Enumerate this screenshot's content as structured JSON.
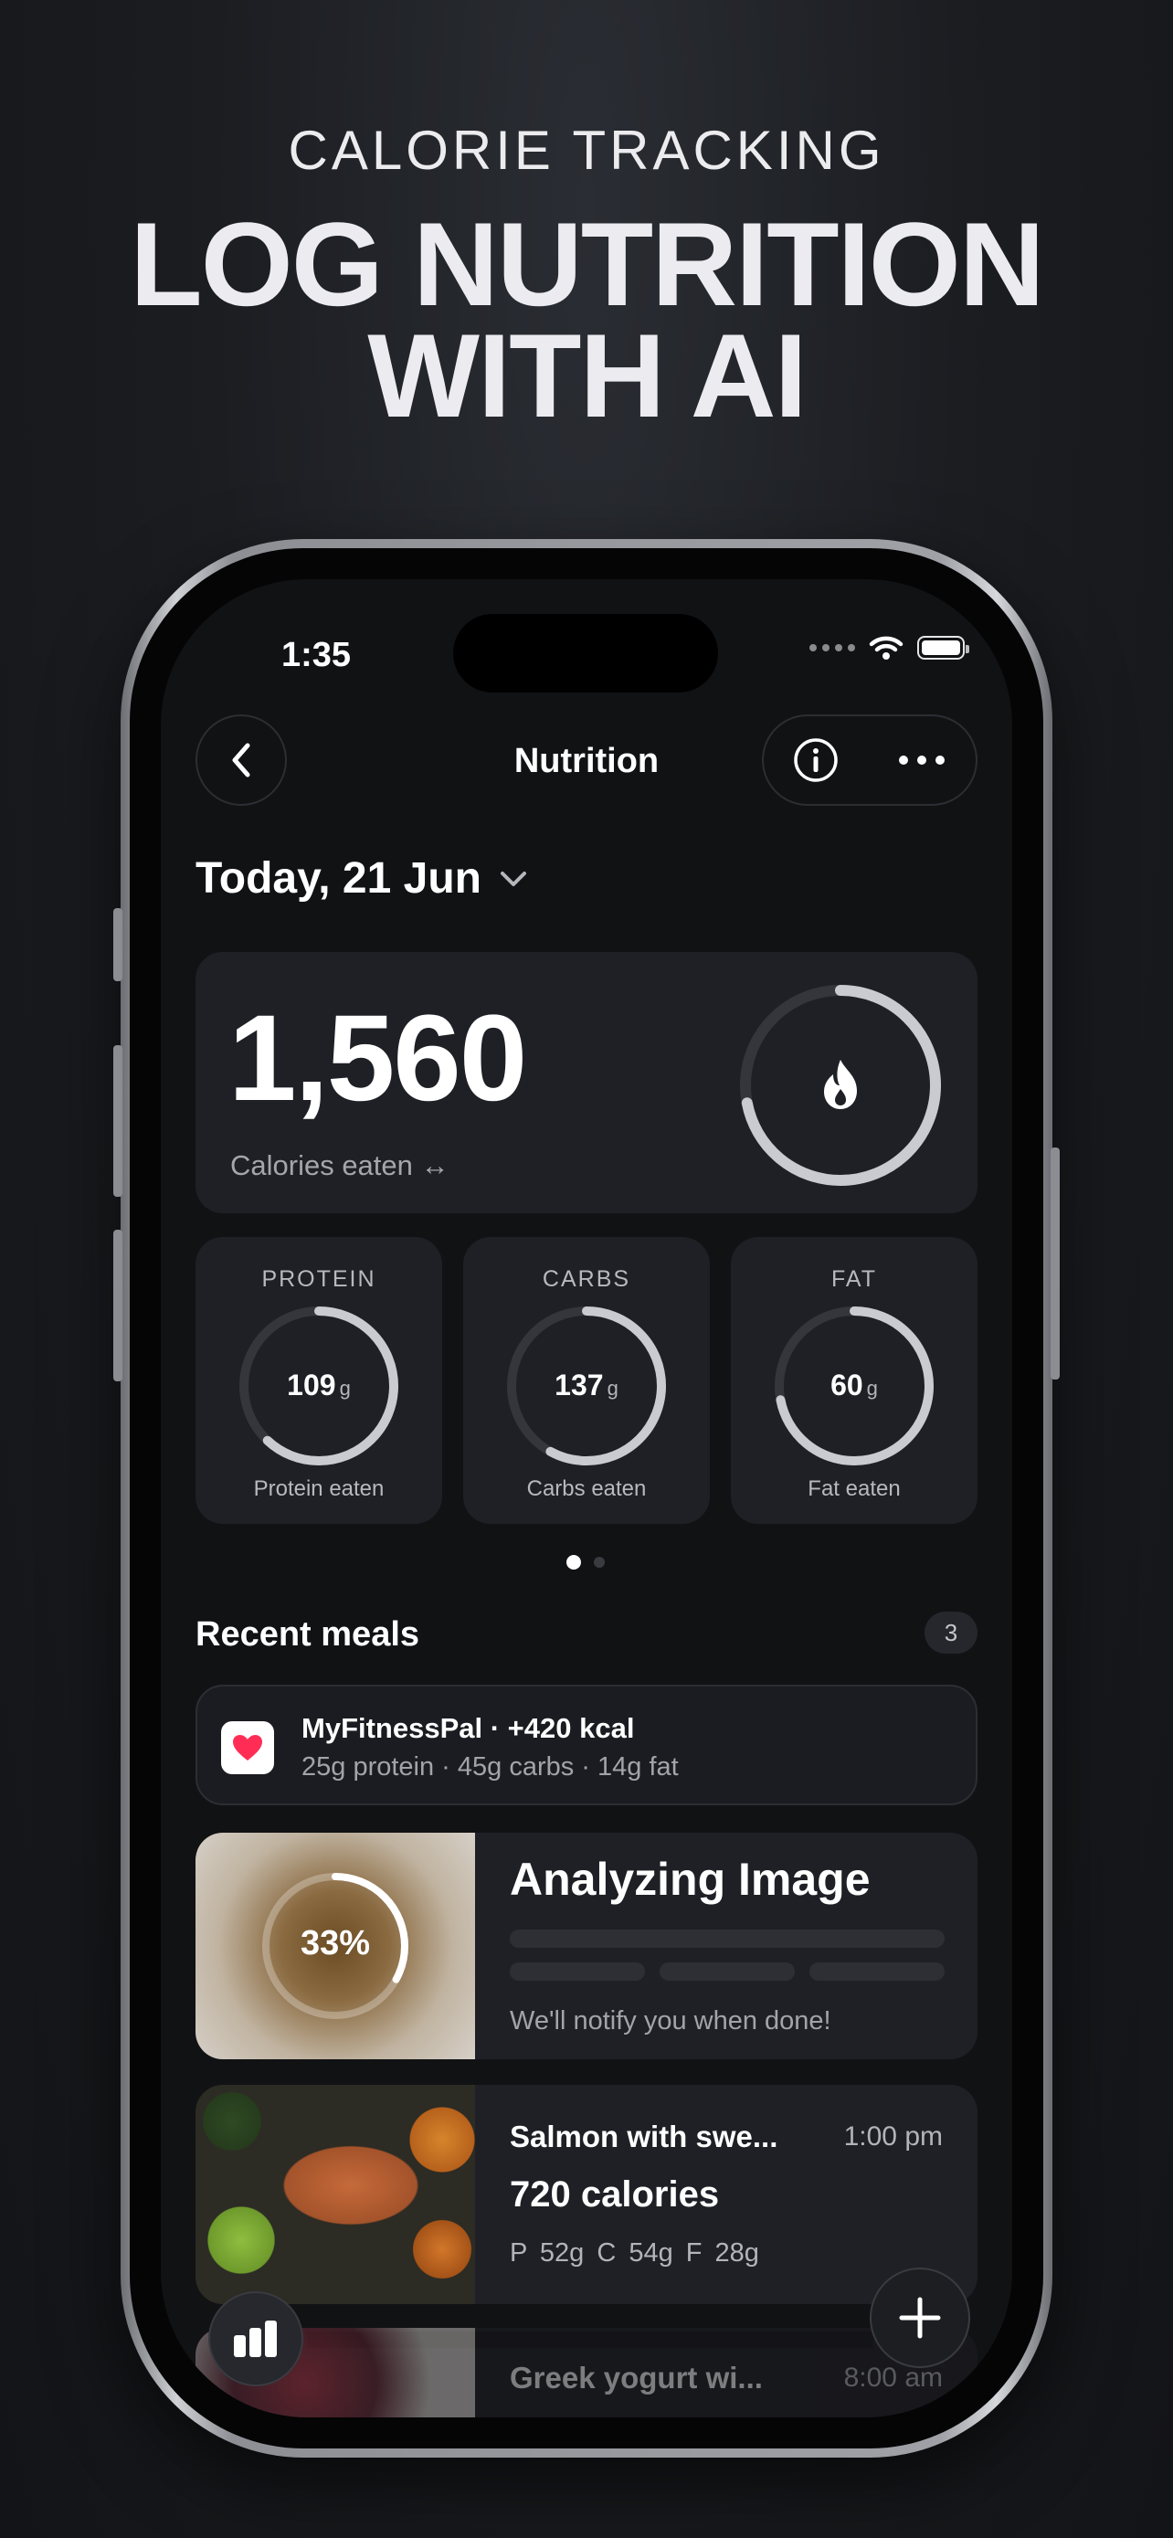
{
  "hero": {
    "eyebrow": "CALORIE TRACKING",
    "headline_line1": "LOG NUTRITION",
    "headline_line2": "WITH AI"
  },
  "status_bar": {
    "time": "1:35"
  },
  "nav": {
    "title": "Nutrition"
  },
  "date": {
    "label": "Today, 21 Jun"
  },
  "calories": {
    "value": "1,560",
    "label": "Calories eaten ↔",
    "ring_progress": 0.72
  },
  "macros": [
    {
      "title": "PROTEIN",
      "value": "109",
      "unit": "g",
      "label": "Protein eaten",
      "progress": 0.62
    },
    {
      "title": "CARBS",
      "value": "137",
      "unit": "g",
      "label": "Carbs eaten",
      "progress": 0.58
    },
    {
      "title": "FAT",
      "value": "60",
      "unit": "g",
      "label": "Fat eaten",
      "progress": 0.72
    }
  ],
  "pager": {
    "active": 0,
    "count": 2
  },
  "recent": {
    "title": "Recent meals",
    "count": "3",
    "sync_item": {
      "title": "MyFitnessPal · +420 kcal",
      "subtitle": "25g protein · 45g carbs · 14g fat"
    },
    "analyzing": {
      "title": "Analyzing Image",
      "progress_label": "33%",
      "progress": 0.33,
      "note": "We'll notify you when done!"
    },
    "meals": [
      {
        "name": "Salmon with swe...",
        "time": "1:00 pm",
        "calories": "720 calories",
        "macros": "P 52g   C 54g   F 28g"
      },
      {
        "name": "Greek yogurt wi...",
        "time": "8:00 am"
      }
    ]
  },
  "colors": {
    "background": "#17181b",
    "card": "#1f2026",
    "ring_track": "#34363c",
    "ring_fill": "#c9cbd0"
  }
}
